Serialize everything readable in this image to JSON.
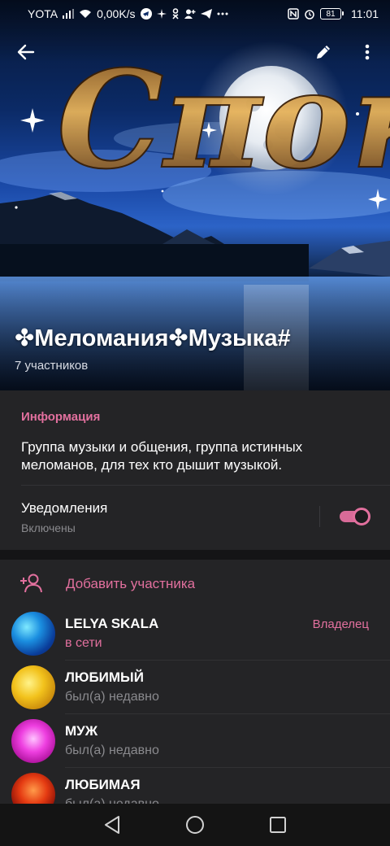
{
  "status_bar": {
    "carrier": "YOTA",
    "speed": "0,00K/s",
    "battery": "81",
    "time": "11:01"
  },
  "header": {
    "cover_lettering": "Сπок",
    "title": "✤Меломания✤Музыка#",
    "member_count": "7 участников"
  },
  "info": {
    "heading": "Информация",
    "description": "Группа музыки и общения, группа истинных меломанов, для тех кто дышит музыкой.",
    "notifications_label": "Уведомления",
    "notifications_status": "Включены",
    "notifications_enabled": true
  },
  "members": {
    "add_label": "Добавить участника",
    "list": [
      {
        "name": "LELYA SKALA",
        "status": "в сети",
        "role": "Владелец",
        "avatar": "blue"
      },
      {
        "name": "ЛЮБИМЫЙ",
        "status": "был(а) недавно",
        "role": "",
        "avatar": "gold"
      },
      {
        "name": "МУЖ",
        "status": "был(а) недавно",
        "role": "",
        "avatar": "pink"
      },
      {
        "name": "ЛЮБИМАЯ",
        "status": "был(а) недавно",
        "role": "",
        "avatar": "red"
      }
    ]
  },
  "colors": {
    "accent": "#e2709e",
    "background": "#242426",
    "secondary_text": "#8a8a8e"
  },
  "icons": {
    "back": "arrow-left-icon",
    "edit": "pencil-icon",
    "more": "more-vertical-icon",
    "add_member": "add-person-icon",
    "nav_back": "triangle-back-icon",
    "nav_home": "circle-home-icon",
    "nav_recents": "square-recents-icon"
  }
}
